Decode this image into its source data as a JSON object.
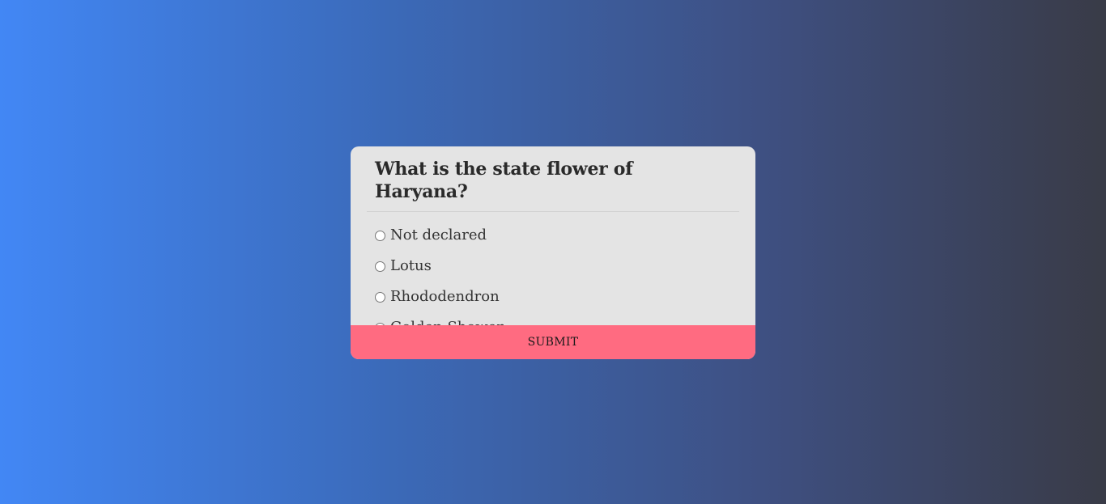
{
  "quiz": {
    "question": "What is the state flower of Haryana?",
    "answers": [
      {
        "label": "Not declared"
      },
      {
        "label": "Lotus"
      },
      {
        "label": "Rhododendron"
      },
      {
        "label": "Golden Shower"
      }
    ],
    "submit_label": "SUBMIT"
  },
  "colors": {
    "card_background": "#e4e4e4",
    "submit_button": "#ff6b81",
    "gradient_start": "#4287f5",
    "gradient_end": "#393b47"
  }
}
